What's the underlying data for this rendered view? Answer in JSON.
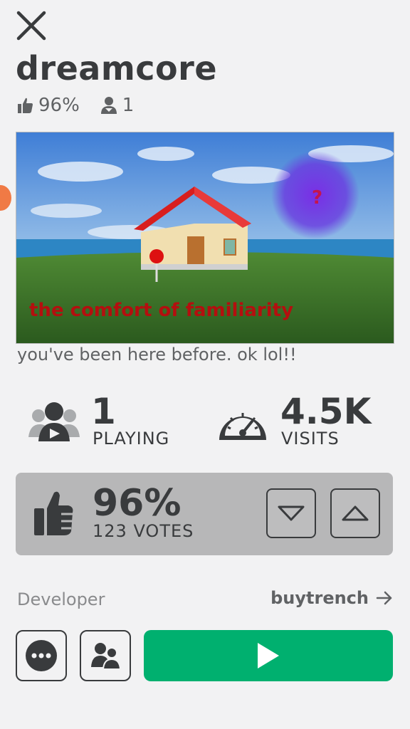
{
  "game": {
    "title": "dreamcore",
    "like_percent": "96%",
    "player_count": "1",
    "description": "you've been here before. ok lol!!",
    "thumbnail_caption": "the comfort of familiarity",
    "thumbnail_symbol": "?"
  },
  "stats": {
    "playing_value": "1",
    "playing_label": "PLAYING",
    "visits_value": "4.5K",
    "visits_label": "VISITS"
  },
  "votes": {
    "percent": "96%",
    "count_label": "123 VOTES"
  },
  "developer": {
    "label": "Developer",
    "name": "buytrench"
  },
  "colors": {
    "play_green": "#00b06f",
    "text_dark": "#393b3d",
    "vote_panel": "#b7b7b8",
    "background": "#f2f2f3"
  },
  "icons": [
    "close-icon",
    "thumbs-up-icon",
    "person-icon",
    "players-icon",
    "speedometer-icon",
    "thumbs-down-arrow-icon",
    "thumbs-up-arrow-icon",
    "more-icon",
    "friends-icon",
    "play-icon",
    "arrow-right-icon"
  ]
}
